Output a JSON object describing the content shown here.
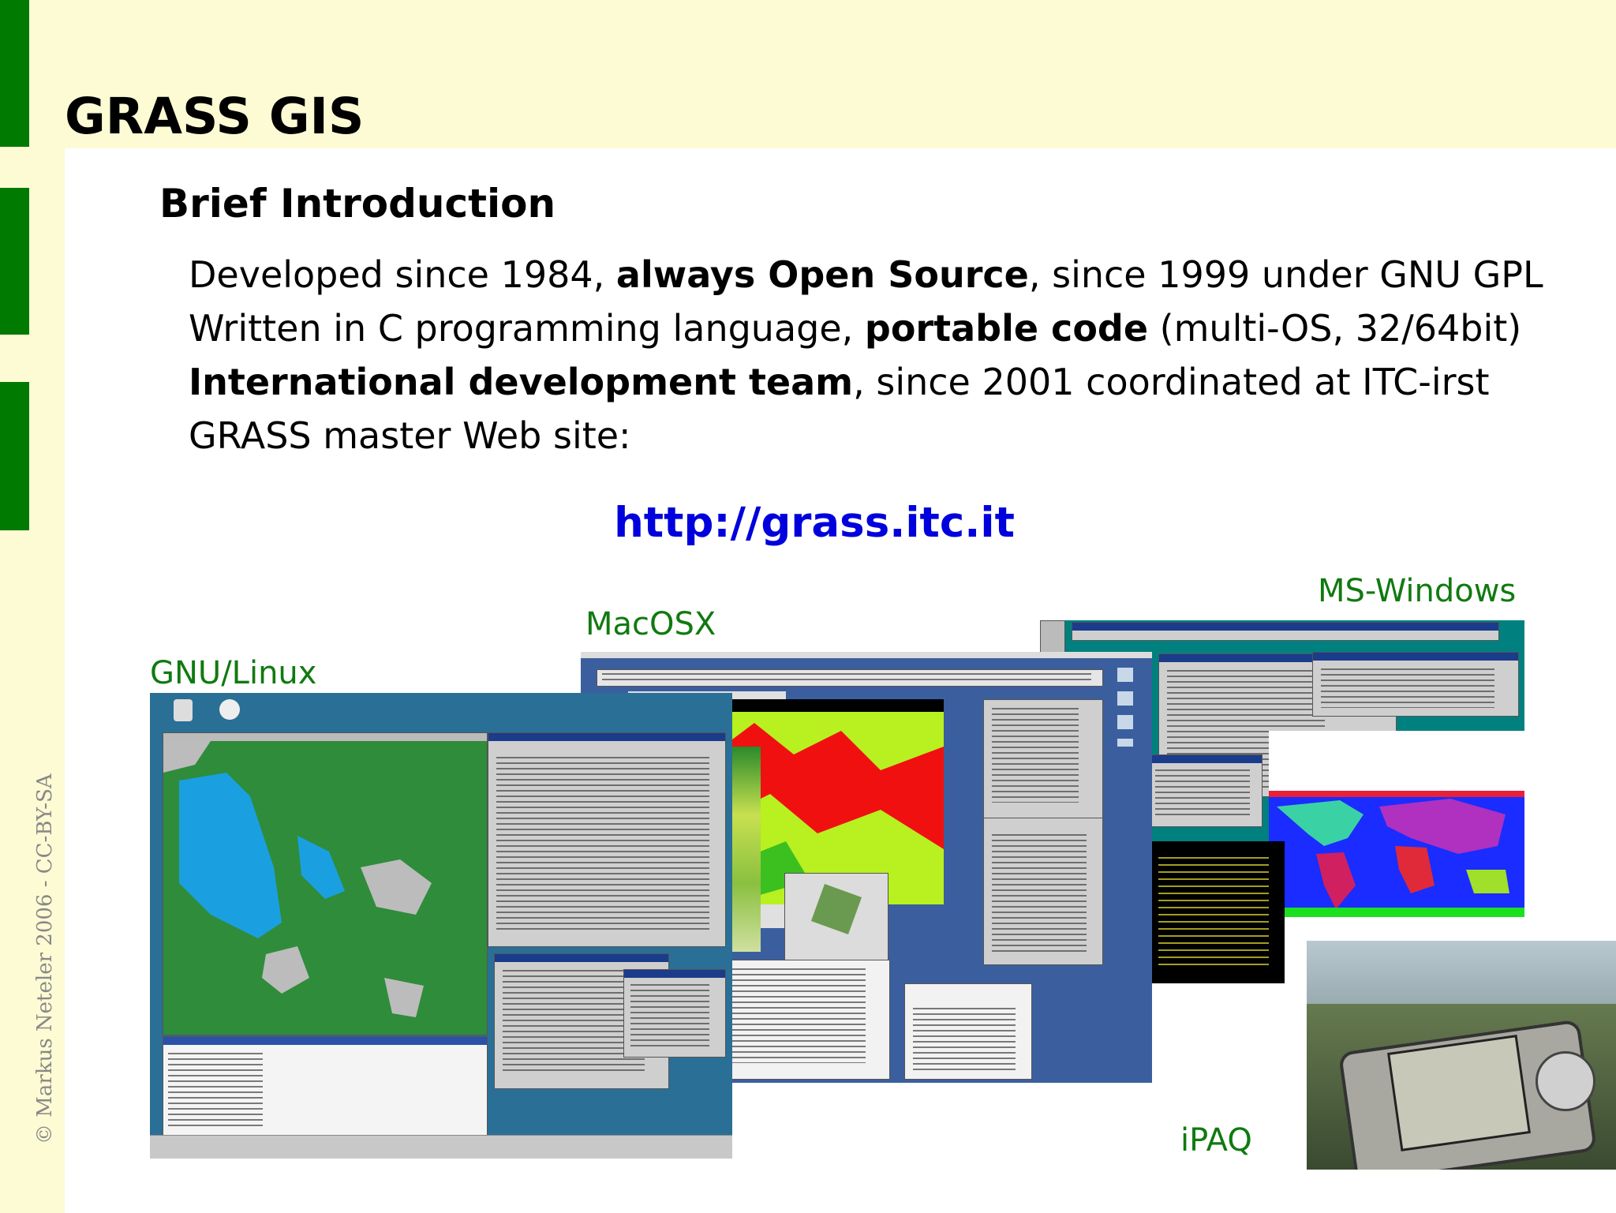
{
  "slide": {
    "title": "GRASS GIS",
    "copyright": "© Markus Neteler 2006 - CC-BY-SA",
    "subtitle": "Brief Introduction",
    "lines": [
      {
        "a": "Developed since 1984, ",
        "b": "always Open Source",
        "c": ", since 1999 under GNU GPL"
      },
      {
        "a": "Written in C programming language, ",
        "b": "portable code",
        "c": " (multi-OS, 32/64bit)"
      },
      {
        "b": "International development team",
        "c": ", since 2001 coordinated at ITC-irst"
      },
      {
        "a": "GRASS master Web site:"
      }
    ],
    "url": "http://grass.itc.it",
    "platforms": {
      "linux": "GNU/Linux",
      "mac": "MacOSX",
      "windows": "MS-Windows",
      "ipaq": "iPAQ"
    }
  },
  "colors": {
    "background": "#fdfbd4",
    "accent_bar": "#007a00",
    "link": "#0000dd",
    "platform_label": "#107a10"
  }
}
